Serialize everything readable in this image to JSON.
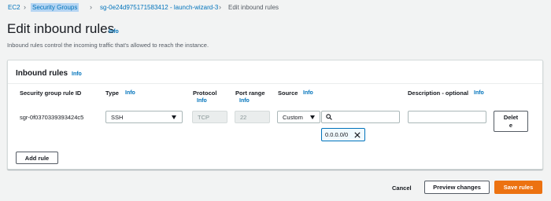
{
  "breadcrumb": {
    "items": [
      "EC2",
      "Security Groups",
      "sg-0e24d975171583412 - launch-wizard-3",
      "Edit inbound rules"
    ]
  },
  "page": {
    "title": "Edit inbound rules",
    "title_info": "Info",
    "description": "Inbound rules control the incoming traffic that's allowed to reach the instance."
  },
  "panel": {
    "title": "Inbound rules",
    "title_info": "Info",
    "columns": {
      "rule_id": "Security group rule ID",
      "type": "Type",
      "type_info": "Info",
      "protocol": "Protocol",
      "protocol_info": "Info",
      "port_range": "Port range",
      "port_range_info": "Info",
      "source": "Source",
      "source_info": "Info",
      "description": "Description - optional",
      "description_info": "Info"
    },
    "row": {
      "rule_id": "sgr-0f0370339393424c5",
      "type": "SSH",
      "protocol": "TCP",
      "port_range": "22",
      "source_type": "Custom",
      "source_search": "",
      "cidr_token": "0.0.0.0/0",
      "description": "",
      "delete_label_1": "Delet",
      "delete_label_2": "e"
    },
    "add_rule": "Add rule"
  },
  "footer": {
    "cancel": "Cancel",
    "preview": "Preview changes",
    "save": "Save rules"
  },
  "colors": {
    "link": "#0073bb",
    "primary": "#ec7211",
    "background": "#f2f3f3"
  }
}
